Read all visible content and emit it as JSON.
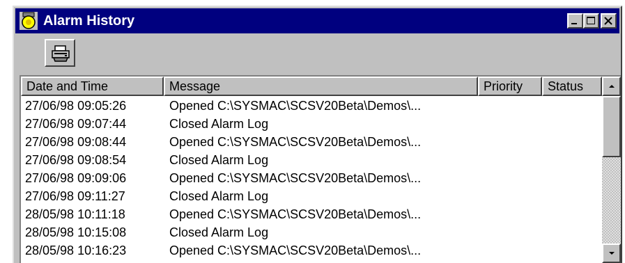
{
  "window": {
    "title": "Alarm History",
    "icon": "alarm-bell-icon",
    "controls": [
      "minimize-icon",
      "maximize-icon",
      "close-icon"
    ],
    "title_bar_color": "#00007f"
  },
  "toolbar": {
    "print_icon": "printer-icon"
  },
  "table": {
    "columns": [
      "Date and Time",
      "Message",
      "Priority",
      "Status"
    ],
    "rows": [
      {
        "date_time": "27/06/98  09:05:26",
        "message": "Opened C:\\SYSMAC\\SCSV20Beta\\Demos\\...",
        "priority": "",
        "status": ""
      },
      {
        "date_time": "27/06/98  09:07:44",
        "message": "Closed Alarm Log",
        "priority": "",
        "status": ""
      },
      {
        "date_time": "27/06/98  09:08:44",
        "message": "Opened C:\\SYSMAC\\SCSV20Beta\\Demos\\...",
        "priority": "",
        "status": ""
      },
      {
        "date_time": "27/06/98  09:08:54",
        "message": "Closed Alarm Log",
        "priority": "",
        "status": ""
      },
      {
        "date_time": "27/06/98  09:09:06",
        "message": "Opened C:\\SYSMAC\\SCSV20Beta\\Demos\\...",
        "priority": "",
        "status": ""
      },
      {
        "date_time": "27/06/98  09:11:27",
        "message": "Closed Alarm Log",
        "priority": "",
        "status": ""
      },
      {
        "date_time": "28/05/98  10:11:18",
        "message": "Opened C:\\SYSMAC\\SCSV20Beta\\Demos\\...",
        "priority": "",
        "status": ""
      },
      {
        "date_time": "28/05/98  10:15:08",
        "message": "Closed Alarm Log",
        "priority": "",
        "status": ""
      },
      {
        "date_time": "28/05/98  10:16:23",
        "message": "Opened C:\\SYSMAC\\SCSV20Beta\\Demos\\...",
        "priority": "",
        "status": ""
      }
    ]
  },
  "scrollbar": {
    "up_icon": "scroll-up-arrow-icon",
    "down_icon": "scroll-down-arrow-icon"
  }
}
